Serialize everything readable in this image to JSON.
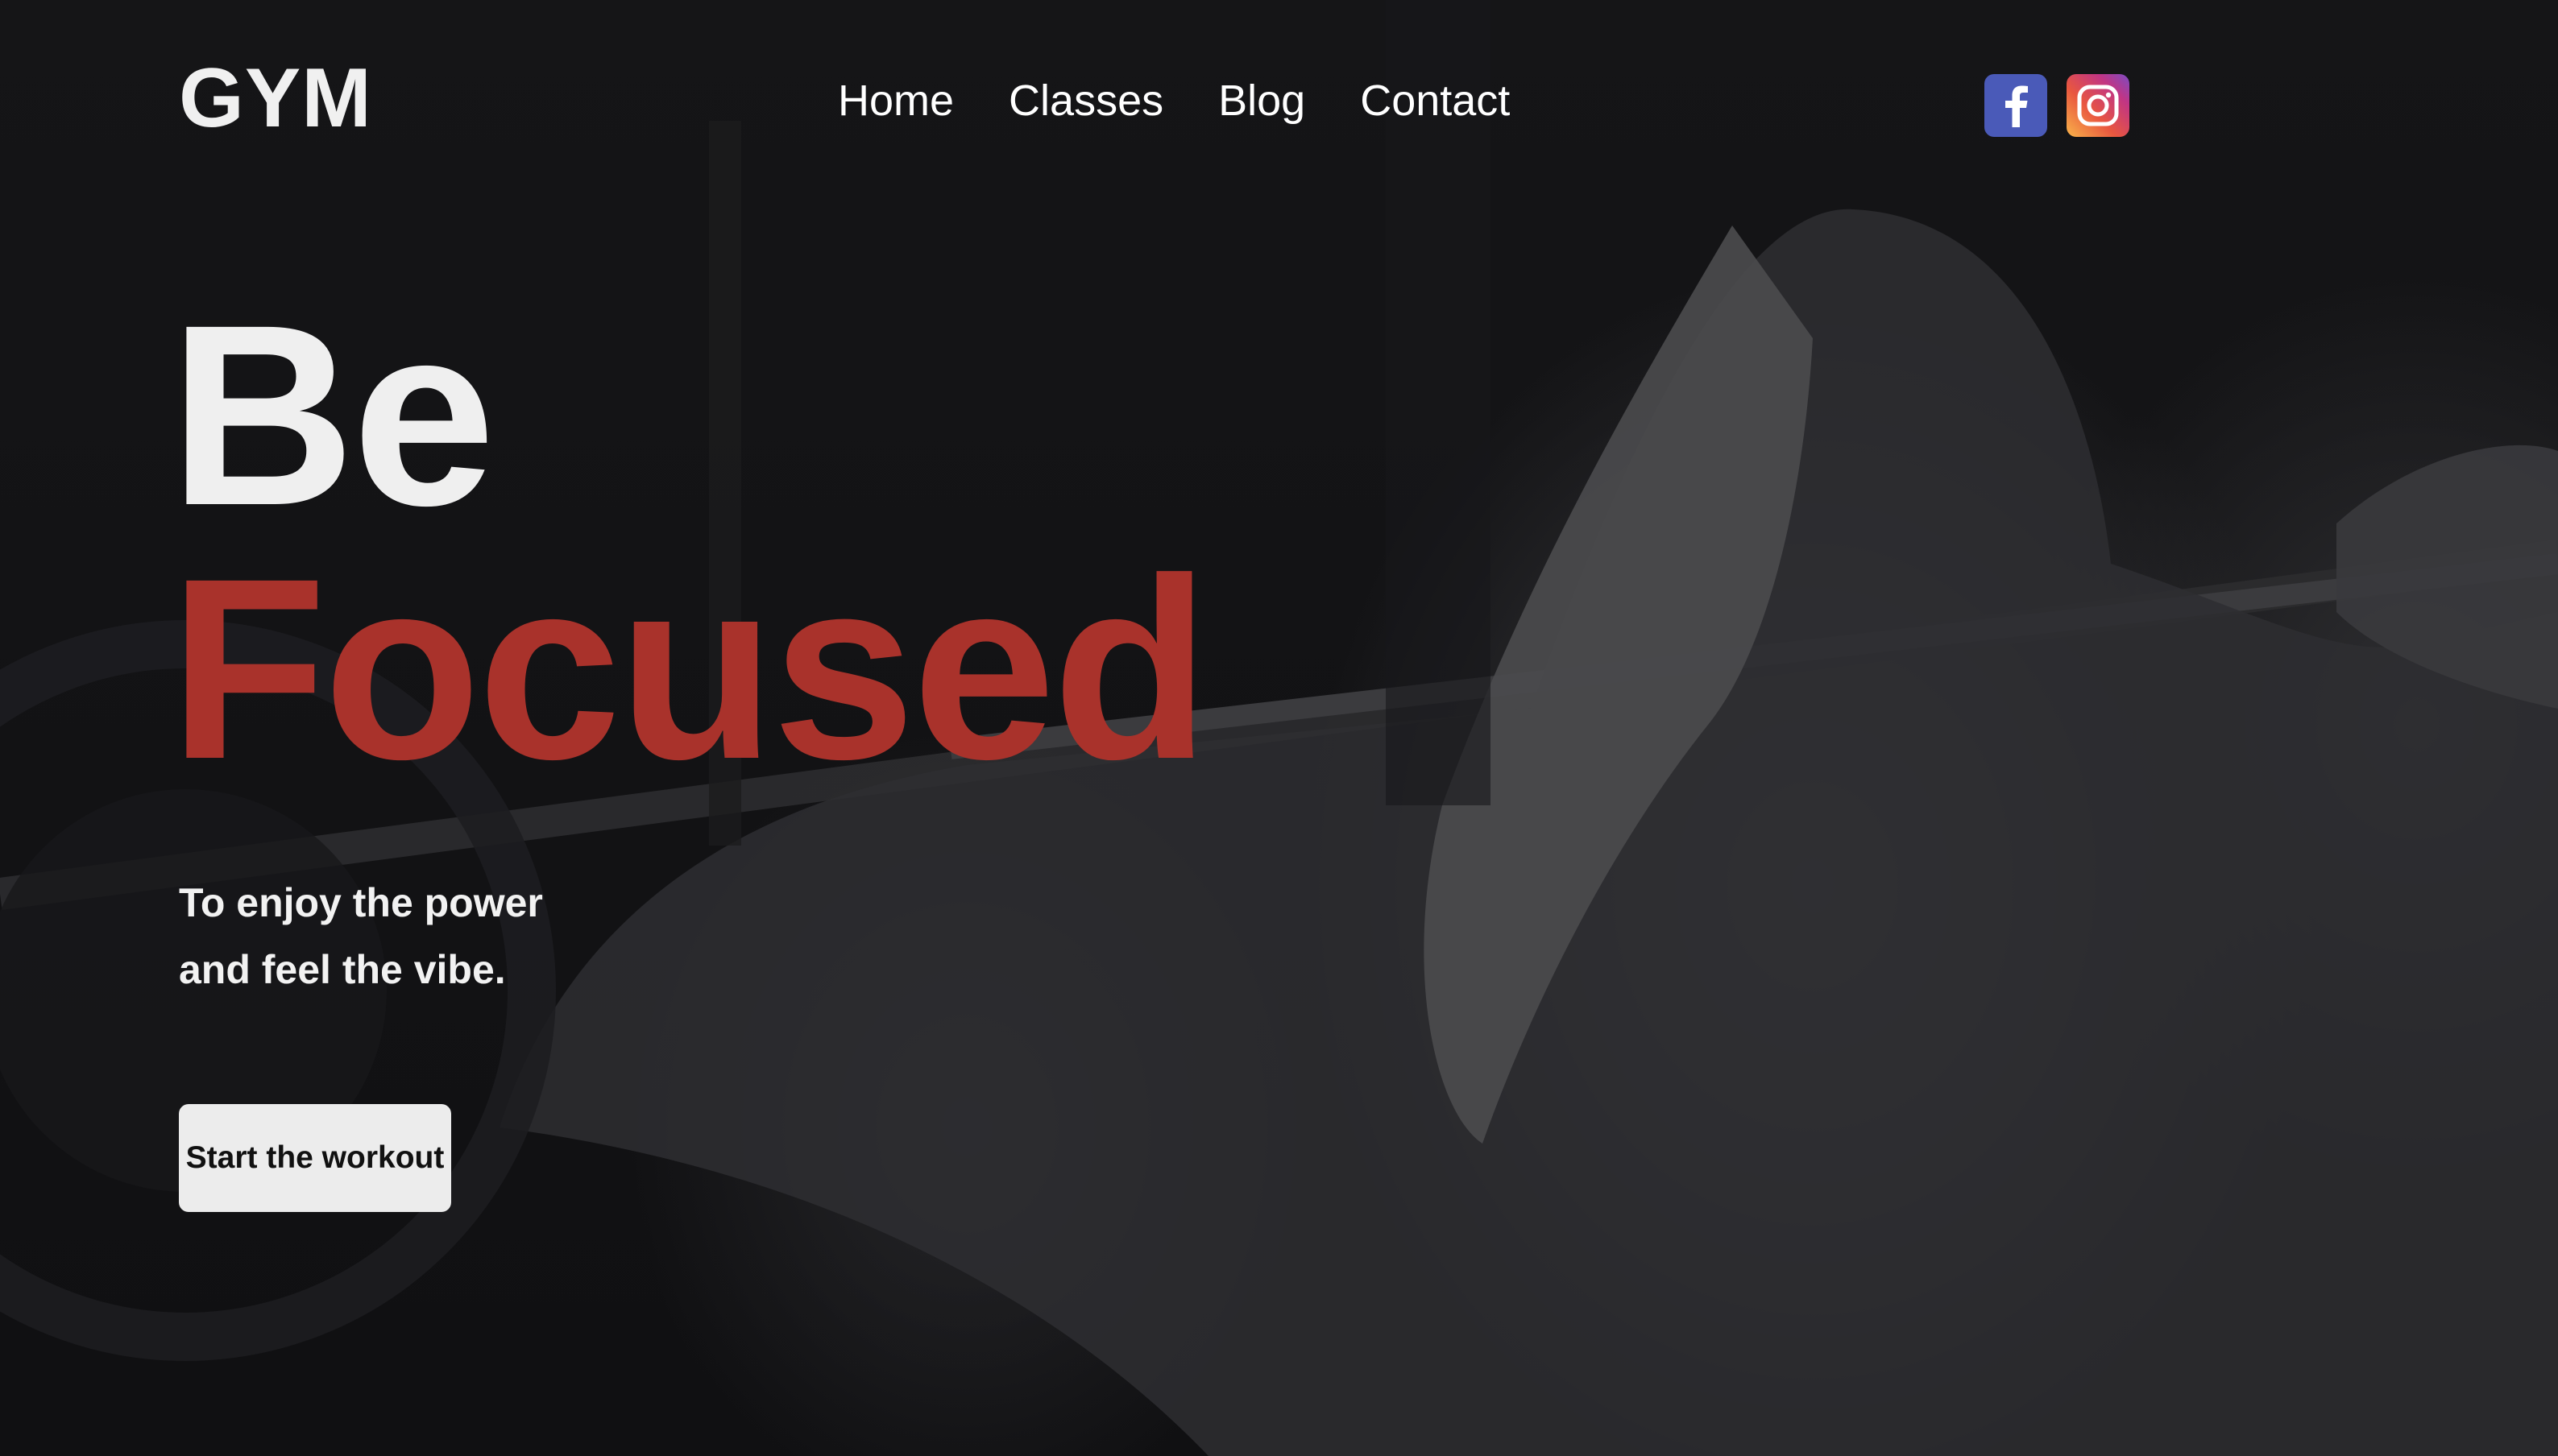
{
  "header": {
    "logo": "GYM",
    "nav": [
      {
        "label": "Home"
      },
      {
        "label": "Classes"
      },
      {
        "label": "Blog"
      },
      {
        "label": "Contact"
      }
    ],
    "social": [
      {
        "icon": "facebook-icon",
        "color": "#4a5ab8"
      },
      {
        "icon": "instagram-icon",
        "color": "#e1306c"
      }
    ]
  },
  "hero": {
    "headline_line1": "Be",
    "headline_line2": "Focused",
    "headline_accent_color": "#a9322b",
    "tagline_line1": "To enjoy the power",
    "tagline_line2": "and feel the vibe.",
    "cta_label": "Start the workout",
    "background_image": "woman-lifting-barbell-photo"
  }
}
